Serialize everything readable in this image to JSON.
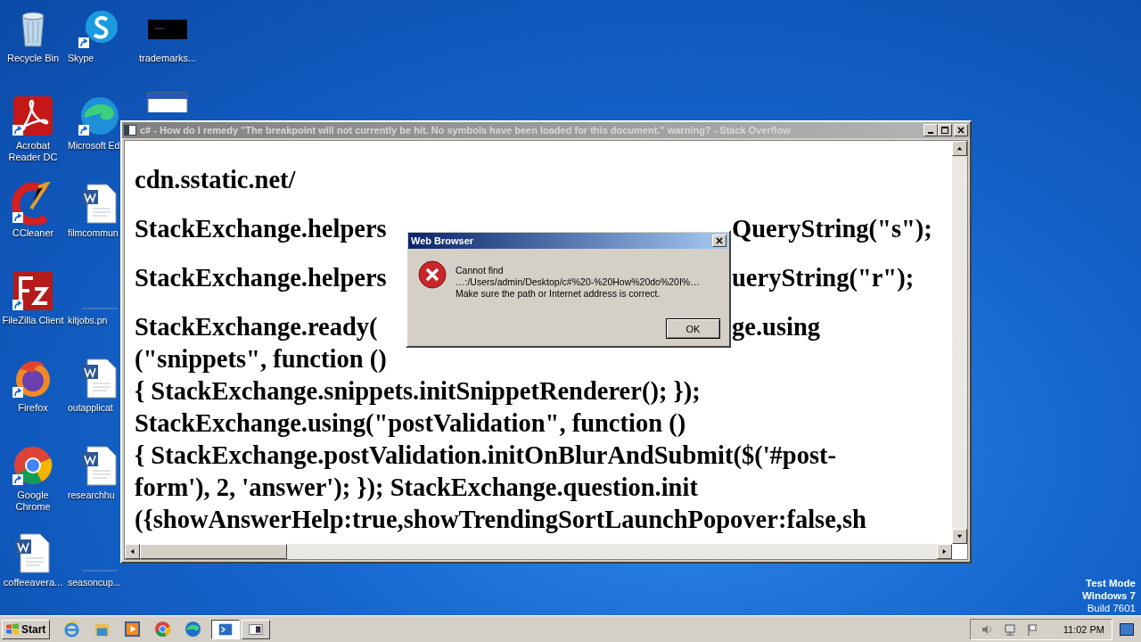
{
  "desktop": {
    "columns": [
      [
        {
          "label": "Recycle Bin",
          "kind": "recycle"
        },
        {
          "label": "Acrobat Reader DC",
          "kind": "pdf"
        },
        {
          "label": "CCleaner",
          "kind": "ccleaner"
        },
        {
          "label": "FileZilla Client",
          "kind": "filezilla"
        },
        {
          "label": "Firefox",
          "kind": "firefox"
        },
        {
          "label": "Google Chrome",
          "kind": "chrome"
        },
        {
          "label": "coffeeavera...",
          "kind": "word"
        }
      ],
      [
        {
          "label": "Skype",
          "kind": "skype"
        },
        {
          "label": "Microsoft Ed",
          "kind": "edge"
        },
        {
          "label": "filmcommun",
          "kind": "word"
        },
        {
          "label": "kitjobs.pn",
          "kind": "blank"
        },
        {
          "label": "outapplicat",
          "kind": "word"
        },
        {
          "label": "researchhu",
          "kind": "word"
        },
        {
          "label": "seasoncup...",
          "kind": "blank"
        }
      ],
      [
        {
          "label": "trademarks...",
          "kind": "dark"
        },
        {
          "kind": "window"
        }
      ]
    ]
  },
  "browser_window": {
    "title": "c# - How do I remedy \"The breakpoint will not currently be hit. No symbols have been loaded for this document.\" warning? - Stack Overflow",
    "content": [
      {
        "left": "cdn.sstatic.net/"
      },
      {
        "left": "StackExchange.helpers",
        "right": "QueryString(\"s\");"
      },
      {
        "left": "StackExchange.helpers",
        "right": "ueryString(\"r\");"
      },
      {
        "left": "StackExchange.ready(",
        "right": "ge.using",
        "more": [
          "(\"snippets\", function ()",
          "{ StackExchange.snippets.initSnippetRenderer(); });",
          "StackExchange.using(\"postValidation\", function ()",
          "{ StackExchange.postValidation.initOnBlurAndSubmit($('#post-",
          "form'), 2, 'answer'); }); StackExchange.question.init",
          "({showAnswerHelp:true,showTrendingSortLaunchPopover:false,sh"
        ]
      }
    ]
  },
  "dialog": {
    "title": "Web Browser",
    "message": [
      "Cannot find",
      "…:/Users/admin/Desktop/c#%20-%20How%20do%20I%…",
      "Make sure the path or Internet address is correct."
    ],
    "button": "OK"
  },
  "taskbar": {
    "start": "Start",
    "tasks": [
      {
        "selected": true
      },
      {
        "selected": false
      }
    ],
    "clock": "11:02 PM"
  },
  "system_notice": [
    "Test Mode",
    "Windows 7",
    "Build 7601"
  ]
}
